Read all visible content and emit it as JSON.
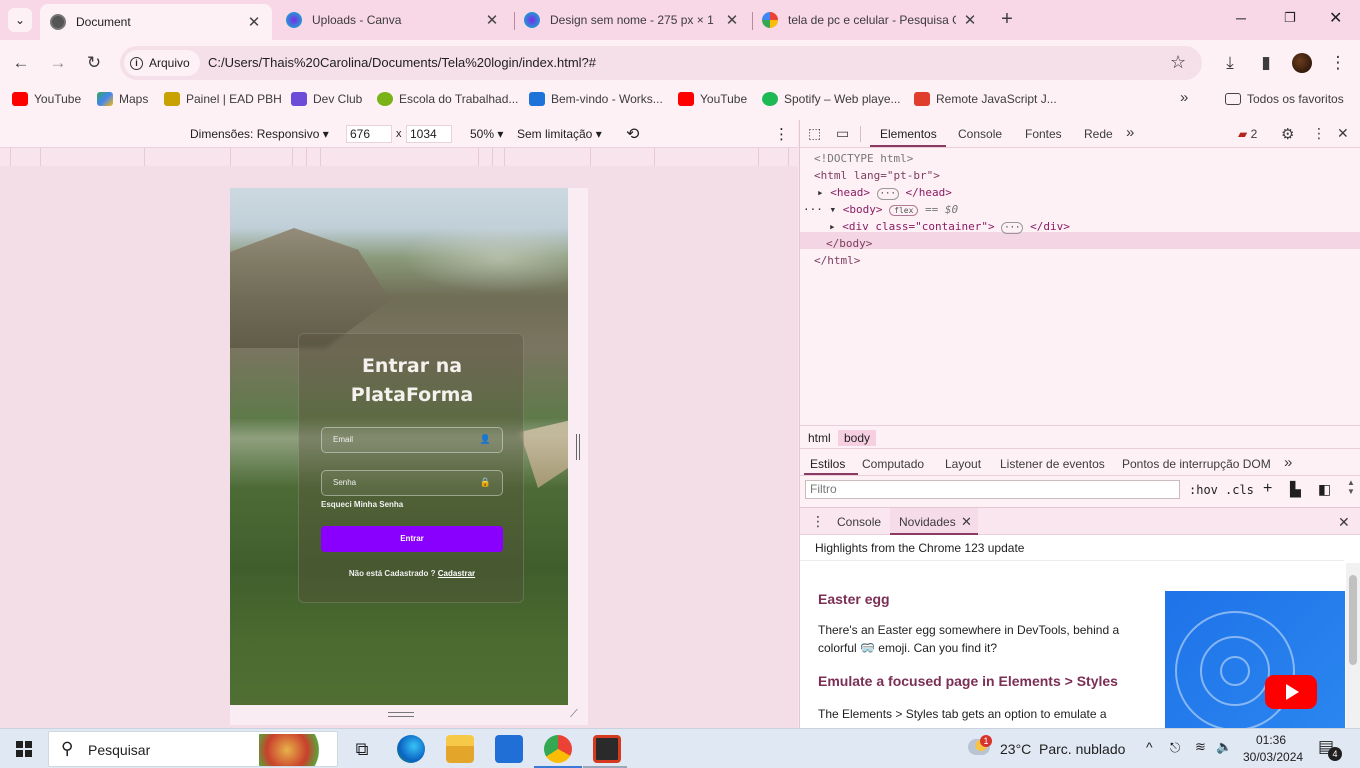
{
  "browser": {
    "tabs": [
      {
        "title": "Document",
        "active": true,
        "favicon": "globe-icon"
      },
      {
        "title": "Uploads - Canva",
        "active": false,
        "favicon": "canva-icon"
      },
      {
        "title": "Design sem nome - 275 px × 1",
        "active": false,
        "favicon": "canva-icon"
      },
      {
        "title": "tela de pc e celular - Pesquisa G",
        "active": false,
        "favicon": "google-icon"
      }
    ],
    "new_tab_label": "+",
    "security_label": "Arquivo",
    "url": "C:/Users/Thais%20Carolina/Documents/Tela%20login/index.html?#",
    "bookmarks": [
      {
        "label": "YouTube",
        "color": "#ff0000"
      },
      {
        "label": "Maps",
        "color": "#34a853"
      },
      {
        "label": "Painel | EAD PBH",
        "color": "#c8a200"
      },
      {
        "label": "Dev Club",
        "color": "#6b4bd8"
      },
      {
        "label": "Escola do Trabalhad...",
        "color": "#7ab317"
      },
      {
        "label": "Bem-vindo - Works...",
        "color": "#1e73d8"
      },
      {
        "label": "YouTube",
        "color": "#ff0000"
      },
      {
        "label": "Spotify – Web playe...",
        "color": "#1db954"
      },
      {
        "label": "Remote JavaScript J...",
        "color": "#e03e2d"
      }
    ],
    "bookmarks_more": "»",
    "all_favorites": "Todos os favoritos"
  },
  "emulation": {
    "dimensions_label": "Dimensões: Responsivo",
    "width": "676",
    "times": "x",
    "height": "1034",
    "zoom": "50%",
    "throttle": "Sem limitação"
  },
  "page": {
    "title_line1": "Entrar na",
    "title_line2": "PlataForma",
    "email_placeholder": "Email",
    "password_placeholder": "Senha",
    "forgot": "Esqueci Minha Senha",
    "login_button": "Entrar",
    "signup_text": "Não está Cadastrado ?",
    "signup_link": "Cadastrar",
    "accent_color": "#8a00ff"
  },
  "devtools": {
    "tabs": [
      "Elementos",
      "Console",
      "Fontes",
      "Rede"
    ],
    "more": "»",
    "issues_count": "2",
    "dom": {
      "doctype": "<!DOCTYPE html>",
      "html_open": "<html lang=\"pt-br\">",
      "head": "<head>",
      "head_close": "</head>",
      "body_open": "<body>",
      "flex_badge": "flex",
      "selected_marker": "== $0",
      "div_line": "<div class=\"container\">",
      "div_close": "</div>",
      "body_close": "</body>",
      "html_close": "</html>"
    },
    "breadcrumbs": [
      "html",
      "body"
    ],
    "styles_tabs": [
      "Estilos",
      "Computado",
      "Layout",
      "Listener de eventos",
      "Pontos de interrupção DOM"
    ],
    "filter_placeholder": "Filtro",
    "hov": ":hov",
    "cls": ".cls",
    "drawer_tabs": [
      "Console",
      "Novidades"
    ],
    "whats_new": {
      "header": "Highlights from the Chrome 123 update",
      "sections": [
        {
          "title": "Easter egg",
          "text": "There's an Easter egg somewhere in DevTools, behind a colorful 🥽 emoji. Can you find it?"
        },
        {
          "title": "Emulate a focused page in Elements > Styles",
          "text": "The Elements > Styles tab gets an option to emulate a"
        }
      ]
    }
  },
  "taskbar": {
    "search_placeholder": "Pesquisar",
    "weather_temp": "23°C",
    "weather_desc": "Parc. nublado",
    "weather_badge": "1",
    "time": "01:36",
    "date": "30/03/2024",
    "notifications": "4"
  }
}
